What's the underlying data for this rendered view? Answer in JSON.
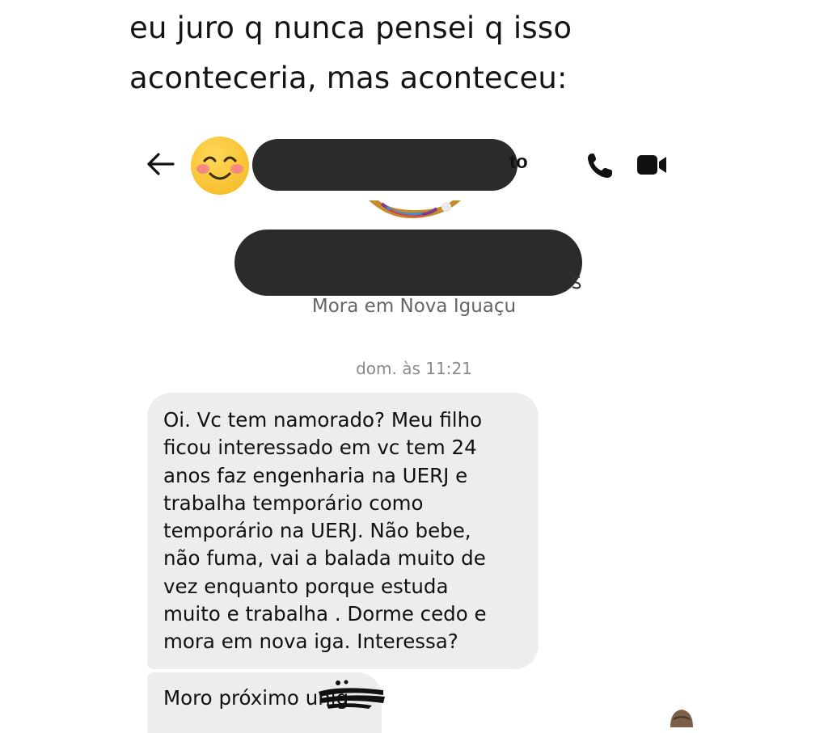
{
  "post": {
    "text": "eu juro q nunca pensei q isso\naconteceria, mas aconteceu:"
  },
  "chat_header": {
    "name_visible_suffix": "to",
    "icons": {
      "back": "back-arrow-icon",
      "avatar": "smiling-face-emoji",
      "call": "phone-icon",
      "video": "video-camera-icon"
    }
  },
  "profile": {
    "location": "Mora em Nova Iguaçu"
  },
  "conversation": {
    "timestamp": "dom. às 11:21",
    "messages": [
      {
        "text": "Oi. Vc tem namorado? Meu filho\nficou interessado em vc tem 24\nanos faz engenharia na UERJ e\ntrabalha temporário como\ntemporário na UERJ. Não bebe,\nnão fuma, vai a balada muito de\nvez enquanto porque estuda\nmuito e trabalha . Dorme cedo e\nmora em nova iga. Interessa?"
      },
      {
        "text": "Moro próximo unig"
      }
    ]
  },
  "colors": {
    "bubble": "#ededf0",
    "redaction": "#2b2b2b",
    "secondary_text": "#666666"
  }
}
